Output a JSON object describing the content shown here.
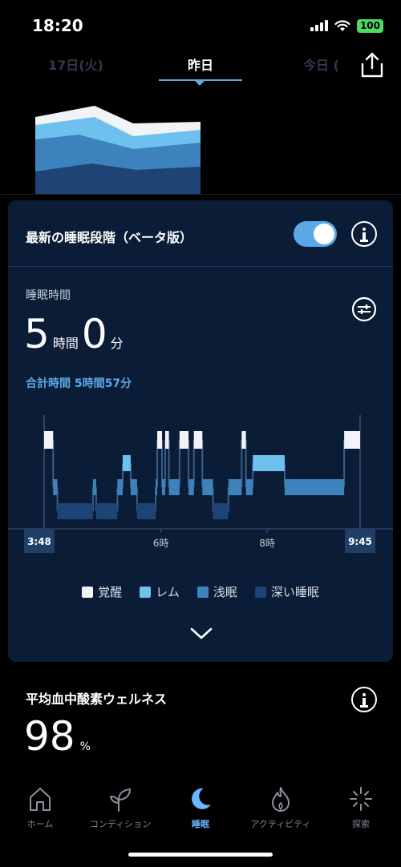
{
  "status": {
    "time": "18:20",
    "battery": "100"
  },
  "date_tabs": {
    "prev": "17日(火)",
    "current": "昨日",
    "next": "今日 ("
  },
  "card": {
    "title": "最新の睡眠段階（ベータ版）",
    "toggle_on": true,
    "sleep_label": "睡眠時間",
    "hours": "5",
    "hours_unit": "時間",
    "minutes": "0",
    "minutes_unit": "分",
    "total_time": "合計時間 5時間57分"
  },
  "chart_data": {
    "type": "area",
    "stages": [
      "覚醒",
      "レム",
      "浅眠",
      "深い睡眠"
    ],
    "colors": {
      "awake": "#f1f3f6",
      "rem": "#6ec0ee",
      "light": "#3d82bd",
      "deep": "#1e4476"
    },
    "start_label": "3:48",
    "end_label": "9:45",
    "x_ticks": [
      "6時",
      "8時"
    ],
    "start_hour": 3.8,
    "end_hour": 9.75,
    "segments": [
      {
        "stage": 0,
        "start": 3.8,
        "end": 3.97
      },
      {
        "stage": 2,
        "start": 3.97,
        "end": 4.05
      },
      {
        "stage": 3,
        "start": 4.05,
        "end": 4.72
      },
      {
        "stage": 2,
        "start": 4.72,
        "end": 4.78
      },
      {
        "stage": 3,
        "start": 4.78,
        "end": 5.18
      },
      {
        "stage": 2,
        "start": 5.18,
        "end": 5.28
      },
      {
        "stage": 1,
        "start": 5.28,
        "end": 5.43
      },
      {
        "stage": 2,
        "start": 5.43,
        "end": 5.55
      },
      {
        "stage": 3,
        "start": 5.55,
        "end": 5.9
      },
      {
        "stage": 2,
        "start": 5.9,
        "end": 5.93
      },
      {
        "stage": 0,
        "start": 5.93,
        "end": 6.02
      },
      {
        "stage": 2,
        "start": 6.02,
        "end": 6.08
      },
      {
        "stage": 0,
        "start": 6.08,
        "end": 6.15
      },
      {
        "stage": 2,
        "start": 6.15,
        "end": 6.35
      },
      {
        "stage": 0,
        "start": 6.35,
        "end": 6.52
      },
      {
        "stage": 2,
        "start": 6.52,
        "end": 6.62
      },
      {
        "stage": 0,
        "start": 6.62,
        "end": 6.78
      },
      {
        "stage": 2,
        "start": 6.78,
        "end": 6.98
      },
      {
        "stage": 3,
        "start": 6.98,
        "end": 7.27
      },
      {
        "stage": 2,
        "start": 7.27,
        "end": 7.52
      },
      {
        "stage": 0,
        "start": 7.52,
        "end": 7.6
      },
      {
        "stage": 2,
        "start": 7.6,
        "end": 7.73
      },
      {
        "stage": 1,
        "start": 7.73,
        "end": 8.33
      },
      {
        "stage": 2,
        "start": 8.33,
        "end": 9.45
      },
      {
        "stage": 0,
        "start": 9.45,
        "end": 9.75
      }
    ]
  },
  "legend": [
    {
      "label": "覚醒",
      "color": "#f1f3f6"
    },
    {
      "label": "レム",
      "color": "#6ec0ee"
    },
    {
      "label": "浅眠",
      "color": "#3d82bd"
    },
    {
      "label": "深い睡眠",
      "color": "#1e4476"
    }
  ],
  "spo2": {
    "title": "平均血中酸素ウェルネス",
    "value": "98",
    "unit": "%"
  },
  "nav": [
    {
      "label": "ホーム",
      "icon": "home-icon",
      "active": false
    },
    {
      "label": "コンディション",
      "icon": "sprout-icon",
      "active": false
    },
    {
      "label": "睡眠",
      "icon": "moon-icon",
      "active": true
    },
    {
      "label": "アクティビティ",
      "icon": "flame-icon",
      "active": false
    },
    {
      "label": "探索",
      "icon": "sparkle-icon",
      "active": false
    }
  ]
}
